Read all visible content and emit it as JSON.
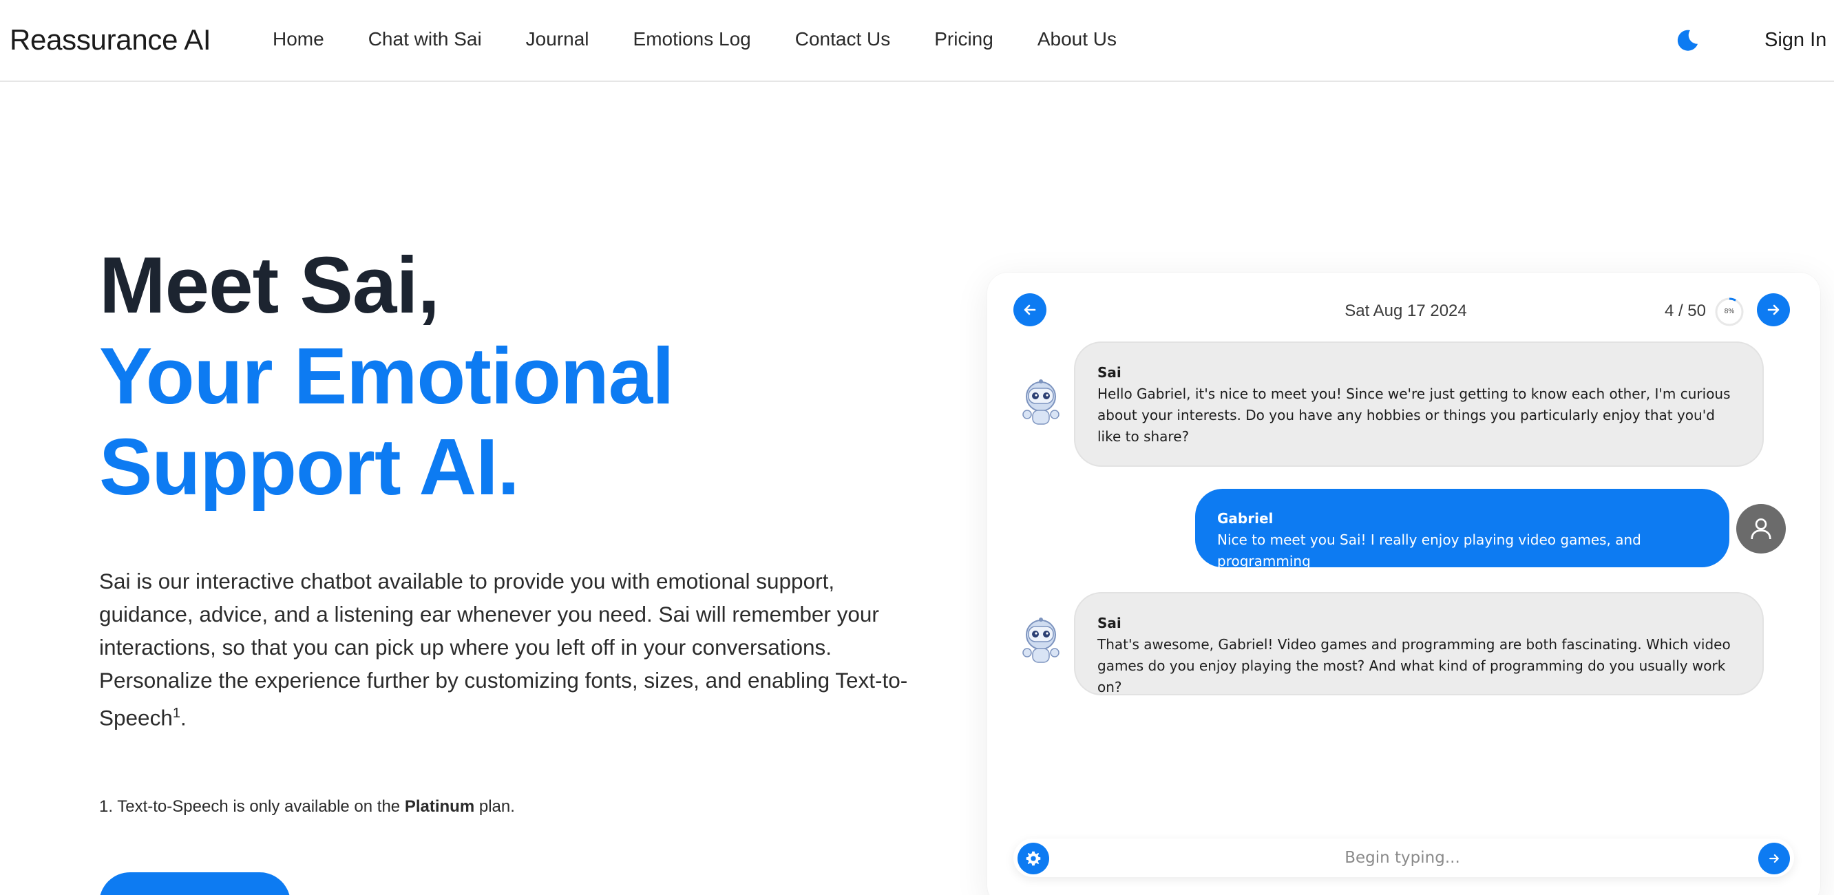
{
  "navbar": {
    "brand": "Reassurance AI",
    "links": [
      "Home",
      "Chat with Sai",
      "Journal",
      "Emotions Log",
      "Contact Us",
      "Pricing",
      "About Us"
    ],
    "theme_icon": "moon-icon",
    "sign_in": "Sign In"
  },
  "hero": {
    "title_line1": "Meet Sai,",
    "title_line2": "Your Emotional",
    "title_line3": "Support AI.",
    "description": "Sai is our interactive chatbot available to provide you with emotional support, guidance, advice, and a listening ear whenever you need. Sai will remember your interactions, so that you can pick up where you left off in your conversations. Personalize the experience further by customizing fonts, sizes, and enabling Text-to-Speech",
    "description_sup": "1",
    "description_end": ".",
    "footnote_prefix": "1. Text-to-Speech is only available on the ",
    "footnote_bold": "Platinum",
    "footnote_suffix": " plan."
  },
  "chat": {
    "date": "Sat Aug 17 2024",
    "count": "4 / 50",
    "progress_label": "8%",
    "progress_value": 0.08,
    "messages": [
      {
        "sender": "Sai",
        "text": "Hello Gabriel, it's nice to meet you! Since we're just getting to know each other, I'm curious about your interests. Do you have any hobbies or things you particularly enjoy that you'd like to share?"
      },
      {
        "sender": "Gabriel",
        "text": "Nice to meet you Sai! I really enjoy playing video games, and programming"
      },
      {
        "sender": "Sai",
        "text": "That's awesome, Gabriel! Video games and programming are both fascinating. Which video games do you enjoy playing the most? And what kind of programming do you usually work on?"
      }
    ],
    "input_placeholder": "Begin typing...",
    "colors": {
      "accent": "#0d7bf2",
      "bot_bubble": "#ececec",
      "user_avatar": "#6b6b6b"
    }
  }
}
